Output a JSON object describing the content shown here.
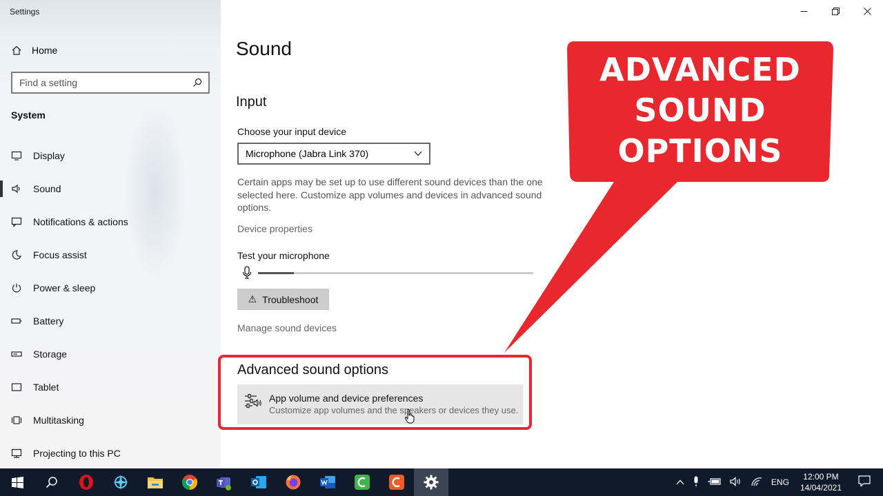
{
  "window": {
    "title": "Settings"
  },
  "sidebar": {
    "home_label": "Home",
    "search_placeholder": "Find a setting",
    "section": "System",
    "items": [
      {
        "label": "Display",
        "icon": "display-icon"
      },
      {
        "label": "Sound",
        "icon": "sound-icon",
        "active": true
      },
      {
        "label": "Notifications & actions",
        "icon": "notifications-icon"
      },
      {
        "label": "Focus assist",
        "icon": "moon-icon"
      },
      {
        "label": "Power & sleep",
        "icon": "power-icon"
      },
      {
        "label": "Battery",
        "icon": "battery-icon"
      },
      {
        "label": "Storage",
        "icon": "storage-icon"
      },
      {
        "label": "Tablet",
        "icon": "tablet-icon"
      },
      {
        "label": "Multitasking",
        "icon": "multitasking-icon"
      },
      {
        "label": "Projecting to this PC",
        "icon": "projecting-icon"
      }
    ]
  },
  "main": {
    "title": "Sound",
    "input": {
      "heading": "Input",
      "choose_label": "Choose your input device",
      "selected_device": "Microphone (Jabra Link 370)",
      "description": "Certain apps may be set up to use different sound devices than the one selected here. Customize app volumes and devices in advanced sound options.",
      "device_properties": "Device properties",
      "test_label": "Test your microphone",
      "mic_level": 0.13,
      "troubleshoot": "Troubleshoot",
      "manage_devices": "Manage sound devices"
    },
    "advanced": {
      "heading": "Advanced sound options",
      "item_title": "App volume and device preferences",
      "item_desc": "Customize app volumes and the speakers or devices they use."
    }
  },
  "callout": {
    "line1": "ADVANCED",
    "line2": "SOUND",
    "line3": "OPTIONS",
    "color": "#e8272e"
  },
  "taskbar": {
    "apps": [
      "start-icon",
      "search-icon",
      "opera-icon",
      "vpn-icon",
      "file-explorer-icon",
      "chrome-icon",
      "teams-icon",
      "outlook-icon",
      "firefox-icon",
      "word-icon",
      "camtasia-icon",
      "camtasia-recorder-icon",
      "settings-icon"
    ],
    "language": "ENG",
    "time": "12:00 PM",
    "date": "14/04/2021"
  }
}
